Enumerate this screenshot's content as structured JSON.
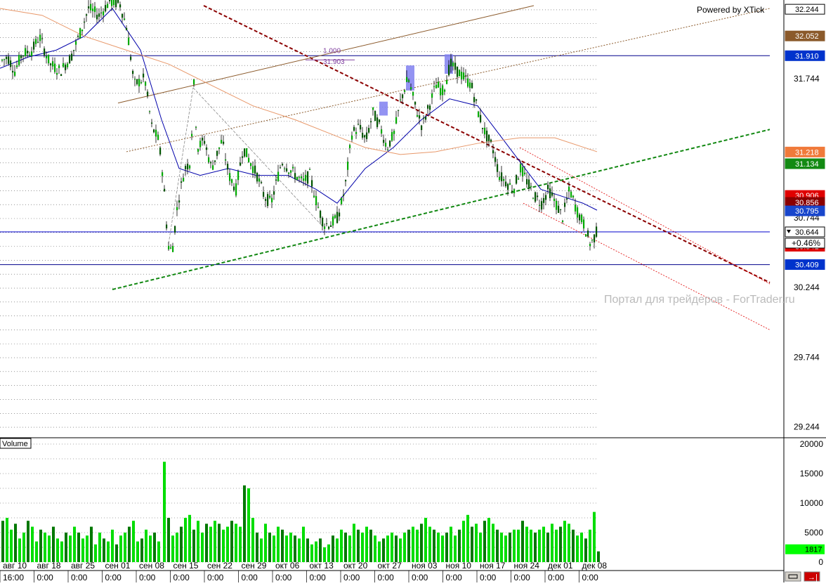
{
  "window": {
    "watermark_top": "Powered by XTick",
    "watermark_site": "Портал для трейдеров - ForTrader.ru",
    "volume_label": "Volume",
    "pct_change": "+0.46%"
  },
  "chart_data": [
    {
      "type": "candlestick",
      "title": "",
      "ylim": [
        29.2,
        32.27
      ],
      "y_ticks": [
        "32.244",
        "31.744",
        "30.744",
        "30.244",
        "29.744",
        "29.244"
      ],
      "x_date_labels": [
        "авг 10",
        "авг 18",
        "авг 25",
        "сен 01",
        "сен 08",
        "сен 15",
        "сен 22",
        "сен 29",
        "окт 06",
        "окт 13",
        "окт 20",
        "окт 27",
        "ноя 03",
        "ноя 10",
        "ноя 17",
        "ноя 24",
        "дек 01",
        "дек 08"
      ],
      "x_time_labels": [
        "16:00",
        "0:00",
        "0:00",
        "0:00",
        "0:00",
        "0:00",
        "0:00",
        "0:00",
        "0:00",
        "0:00",
        "0:00",
        "0:00",
        "0:00",
        "0:00",
        "0:00",
        "0:00",
        "0:00",
        "0:00"
      ],
      "price_path": [
        [
          0,
          31.87
        ],
        [
          10,
          31.9
        ],
        [
          20,
          31.8
        ],
        [
          30,
          31.92
        ],
        [
          45,
          31.95
        ],
        [
          55,
          32.05
        ],
        [
          70,
          31.85
        ],
        [
          85,
          31.8
        ],
        [
          100,
          31.9
        ],
        [
          115,
          32.1
        ],
        [
          125,
          32.25
        ],
        [
          140,
          32.2
        ],
        [
          155,
          32.3
        ],
        [
          170,
          32.28
        ],
        [
          180,
          32.1
        ],
        [
          190,
          31.7
        ],
        [
          205,
          31.75
        ],
        [
          215,
          31.4
        ],
        [
          225,
          31.3
        ],
        [
          232,
          31.0
        ],
        [
          238,
          30.55
        ],
        [
          244,
          30.5
        ],
        [
          252,
          30.85
        ],
        [
          262,
          31.1
        ],
        [
          270,
          31.15
        ],
        [
          275,
          31.7
        ],
        [
          280,
          31.25
        ],
        [
          290,
          31.3
        ],
        [
          300,
          31.1
        ],
        [
          315,
          31.3
        ],
        [
          325,
          31.05
        ],
        [
          335,
          30.95
        ],
        [
          345,
          31.25
        ],
        [
          355,
          31.15
        ],
        [
          365,
          31.05
        ],
        [
          375,
          30.9
        ],
        [
          385,
          30.85
        ],
        [
          400,
          31.15
        ],
        [
          410,
          31.1
        ],
        [
          420,
          31.05
        ],
        [
          430,
          31.0
        ],
        [
          440,
          31.05
        ],
        [
          450,
          30.85
        ],
        [
          460,
          30.7
        ],
        [
          470,
          30.7
        ],
        [
          480,
          30.75
        ],
        [
          490,
          30.95
        ],
        [
          500,
          31.35
        ],
        [
          510,
          31.4
        ],
        [
          520,
          31.3
        ],
        [
          530,
          31.5
        ],
        [
          540,
          31.4
        ],
        [
          550,
          31.25
        ],
        [
          560,
          31.35
        ],
        [
          570,
          31.6
        ],
        [
          580,
          31.75
        ],
        [
          590,
          31.55
        ],
        [
          600,
          31.4
        ],
        [
          610,
          31.55
        ],
        [
          620,
          31.7
        ],
        [
          630,
          31.65
        ],
        [
          640,
          31.85
        ],
        [
          650,
          31.8
        ],
        [
          660,
          31.75
        ],
        [
          670,
          31.7
        ],
        [
          680,
          31.5
        ],
        [
          690,
          31.35
        ],
        [
          700,
          31.25
        ],
        [
          710,
          31.05
        ],
        [
          720,
          31.0
        ],
        [
          730,
          30.95
        ],
        [
          740,
          31.1
        ],
        [
          750,
          31.0
        ],
        [
          760,
          30.9
        ],
        [
          770,
          30.85
        ],
        [
          780,
          30.95
        ],
        [
          790,
          30.85
        ],
        [
          800,
          30.75
        ],
        [
          810,
          30.95
        ],
        [
          820,
          30.8
        ],
        [
          830,
          30.7
        ],
        [
          840,
          30.55
        ],
        [
          848,
          30.64
        ]
      ],
      "overlays": [
        {
          "name": "moving-average-fast",
          "color": "#0000aa",
          "path": [
            [
              0,
              31.82
            ],
            [
              40,
              31.9
            ],
            [
              80,
              31.95
            ],
            [
              120,
              32.05
            ],
            [
              160,
              32.25
            ],
            [
              200,
              31.95
            ],
            [
              230,
              31.45
            ],
            [
              255,
              31.1
            ],
            [
              285,
              31.05
            ],
            [
              325,
              31.1
            ],
            [
              365,
              31.05
            ],
            [
              410,
              31.05
            ],
            [
              450,
              30.95
            ],
            [
              480,
              30.85
            ],
            [
              520,
              31.1
            ],
            [
              560,
              31.25
            ],
            [
              600,
              31.45
            ],
            [
              640,
              31.6
            ],
            [
              680,
              31.55
            ],
            [
              710,
              31.35
            ],
            [
              740,
              31.15
            ],
            [
              770,
              30.95
            ],
            [
              800,
              30.9
            ],
            [
              830,
              30.85
            ],
            [
              850,
              30.8
            ]
          ]
        },
        {
          "name": "moving-average-slow",
          "color": "#e8986a",
          "path": [
            [
              0,
              32.25
            ],
            [
              60,
              32.2
            ],
            [
              120,
              32.05
            ],
            [
              180,
              31.95
            ],
            [
              240,
              31.85
            ],
            [
              300,
              31.7
            ],
            [
              360,
              31.55
            ],
            [
              420,
              31.45
            ],
            [
              470,
              31.35
            ],
            [
              520,
              31.25
            ],
            [
              570,
              31.2
            ],
            [
              620,
              31.22
            ],
            [
              680,
              31.28
            ],
            [
              740,
              31.32
            ],
            [
              790,
              31.32
            ],
            [
              850,
              31.22
            ]
          ]
        }
      ],
      "volume_ylim": [
        0,
        20000
      ],
      "volume_ticks": [
        "20000",
        "15000",
        "10000",
        "5000",
        "0"
      ],
      "volume_series": [
        [
          2,
          7000
        ],
        [
          8,
          7500
        ],
        [
          14,
          5500
        ],
        [
          20,
          6500
        ],
        [
          26,
          4000
        ],
        [
          32,
          5000
        ],
        [
          38,
          7000
        ],
        [
          44,
          6000
        ],
        [
          50,
          3500
        ],
        [
          56,
          5500
        ],
        [
          62,
          5000
        ],
        [
          68,
          4500
        ],
        [
          74,
          6000
        ],
        [
          80,
          4000
        ],
        [
          86,
          3500
        ],
        [
          92,
          5000
        ],
        [
          98,
          4500
        ],
        [
          104,
          6000
        ],
        [
          110,
          5000
        ],
        [
          116,
          4000
        ],
        [
          122,
          4500
        ],
        [
          128,
          6000
        ],
        [
          134,
          3000
        ],
        [
          140,
          5000
        ],
        [
          146,
          4000
        ],
        [
          152,
          3500
        ],
        [
          158,
          5500
        ],
        [
          164,
          3000
        ],
        [
          170,
          4500
        ],
        [
          176,
          5000
        ],
        [
          182,
          6000
        ],
        [
          188,
          7000
        ],
        [
          194,
          3500
        ],
        [
          200,
          4000
        ],
        [
          206,
          5500
        ],
        [
          212,
          4500
        ],
        [
          218,
          5000
        ],
        [
          224,
          3500
        ],
        [
          232,
          17000
        ],
        [
          238,
          7500
        ],
        [
          244,
          4500
        ],
        [
          250,
          5000
        ],
        [
          256,
          6000
        ],
        [
          262,
          7500
        ],
        [
          268,
          8000
        ],
        [
          274,
          5500
        ],
        [
          280,
          7000
        ],
        [
          286,
          5000
        ],
        [
          292,
          6500
        ],
        [
          298,
          6000
        ],
        [
          304,
          7000
        ],
        [
          310,
          6500
        ],
        [
          316,
          5500
        ],
        [
          322,
          6000
        ],
        [
          328,
          7000
        ],
        [
          334,
          6500
        ],
        [
          340,
          6000
        ],
        [
          346,
          13000
        ],
        [
          352,
          12500
        ],
        [
          358,
          7500
        ],
        [
          364,
          5000
        ],
        [
          370,
          4000
        ],
        [
          376,
          6500
        ],
        [
          382,
          5000
        ],
        [
          388,
          4500
        ],
        [
          394,
          6000
        ],
        [
          400,
          5500
        ],
        [
          406,
          4500
        ],
        [
          412,
          5000
        ],
        [
          418,
          4500
        ],
        [
          424,
          4000
        ],
        [
          430,
          6000
        ],
        [
          436,
          4000
        ],
        [
          442,
          3000
        ],
        [
          448,
          3500
        ],
        [
          454,
          4000
        ],
        [
          460,
          2500
        ],
        [
          466,
          3000
        ],
        [
          472,
          4500
        ],
        [
          478,
          4000
        ],
        [
          484,
          5500
        ],
        [
          490,
          5000
        ],
        [
          496,
          4500
        ],
        [
          502,
          6500
        ],
        [
          508,
          5500
        ],
        [
          514,
          5000
        ],
        [
          520,
          6000
        ],
        [
          526,
          5500
        ],
        [
          532,
          4500
        ],
        [
          538,
          3500
        ],
        [
          544,
          4000
        ],
        [
          550,
          4500
        ],
        [
          556,
          5000
        ],
        [
          562,
          4500
        ],
        [
          568,
          4000
        ],
        [
          574,
          5000
        ],
        [
          580,
          5500
        ],
        [
          586,
          6000
        ],
        [
          592,
          5500
        ],
        [
          598,
          6500
        ],
        [
          604,
          7500
        ],
        [
          610,
          6000
        ],
        [
          616,
          5500
        ],
        [
          622,
          5000
        ],
        [
          628,
          4500
        ],
        [
          634,
          5000
        ],
        [
          640,
          6000
        ],
        [
          646,
          4500
        ],
        [
          652,
          5500
        ],
        [
          658,
          7000
        ],
        [
          664,
          8000
        ],
        [
          670,
          6000
        ],
        [
          676,
          6500
        ],
        [
          682,
          5000
        ],
        [
          688,
          7000
        ],
        [
          694,
          7500
        ],
        [
          700,
          6500
        ],
        [
          706,
          5500
        ],
        [
          712,
          5000
        ],
        [
          718,
          4500
        ],
        [
          724,
          5000
        ],
        [
          730,
          5500
        ],
        [
          736,
          5500
        ],
        [
          742,
          7000
        ],
        [
          748,
          6000
        ],
        [
          754,
          5500
        ],
        [
          760,
          5000
        ],
        [
          766,
          5500
        ],
        [
          772,
          6000
        ],
        [
          778,
          5000
        ],
        [
          784,
          6500
        ],
        [
          790,
          5500
        ],
        [
          796,
          6000
        ],
        [
          802,
          7000
        ],
        [
          808,
          6500
        ],
        [
          814,
          5500
        ],
        [
          820,
          4500
        ],
        [
          826,
          5000
        ],
        [
          832,
          4000
        ],
        [
          838,
          5500
        ],
        [
          844,
          8500
        ],
        [
          850,
          1817
        ]
      ],
      "price_tags": [
        {
          "label": "32.244",
          "value": 32.244,
          "bg": "#ffffff",
          "fg": "#000000"
        },
        {
          "label": "32.052",
          "value": 32.052,
          "bg": "#8b5a2b",
          "fg": "#ffffff"
        },
        {
          "label": "31.910",
          "value": 31.91,
          "bg": "#0033cc",
          "fg": "#ffffff"
        },
        {
          "label": "31.218",
          "value": 31.218,
          "bg": "#f07a3a",
          "fg": "#ffffff"
        },
        {
          "label": "31.134",
          "value": 31.134,
          "bg": "#138a13",
          "fg": "#ffffff"
        },
        {
          "label": "30.906",
          "value": 30.906,
          "bg": "#e00000",
          "fg": "#ffffff"
        },
        {
          "label": "30.856",
          "value": 30.856,
          "bg": "#8b0000",
          "fg": "#ffffff"
        },
        {
          "label": "30.795",
          "value": 30.795,
          "bg": "#1846cc",
          "fg": "#ffffff"
        },
        {
          "label": "30.644",
          "value": 30.644,
          "bg": "#ffffff",
          "fg": "#000000"
        },
        {
          "label": "30.541",
          "value": 30.541,
          "bg": "#e00000",
          "fg": "#ffffff"
        },
        {
          "label": "30.409",
          "value": 30.409,
          "bg": "#0033cc",
          "fg": "#ffffff"
        }
      ],
      "volume_tag": {
        "label": "1817",
        "bg": "#00ff00",
        "fg": "#000000"
      },
      "fib_labels": [
        "1.000",
        "31.903"
      ]
    }
  ]
}
